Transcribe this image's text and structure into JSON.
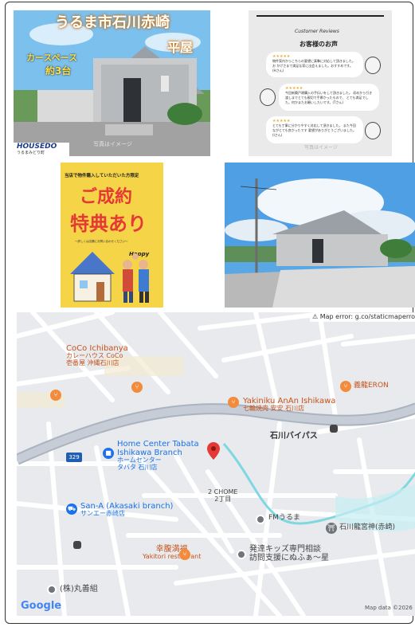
{
  "listing_photo_1": {
    "title": "うるま市石川赤崎",
    "subtitle": "平屋",
    "parking_line1": "カースペース",
    "parking_line2": "約3台",
    "brand": "HOUSEDO",
    "branch": "うるまみどり町",
    "watermark": "写真はイメージ"
  },
  "reviews_card": {
    "heading_en": "Customer Reviews",
    "heading_jp": "お客様のお声",
    "reviews": [
      {
        "stars": "★★★★★",
        "text": "物件案内からこちらの要望に真摯に対応して頂きました。お かげさまで満足な家に出会えました。おすすめです。 (Hさん)"
      },
      {
        "stars": "★★★★★",
        "text": "今回新築戸建購入の手伝いをして頂きました。 初めから引き渡しまでとても親切で手厚かったもので、 とても満足でした。何かまたお願いしたいです。(Tさん)"
      },
      {
        "stars": "★★★★★",
        "text": "とても丁寧に分かりやすく対応して頂きました。 また今回ながとても良かったです 要望がありがとうございました。 (Iさん)"
      }
    ],
    "watermark": "写真はイメージ"
  },
  "campaign_card": {
    "top_text": "当店で物件購入していただいた方限定",
    "headline1": "ご成約",
    "headline2": "特典あり",
    "small_text": "～詳しくは店舗にお問い合わせください～",
    "happy": "Happy"
  },
  "map": {
    "error_text": "Map error: g.co/staticmaperror",
    "google_label": "Google",
    "attribution": "Map data ©2026",
    "route_badge": "329",
    "places": [
      {
        "name": "CoCo Ichibanya",
        "sub1": "カレーハウス CoCo",
        "sub2": "壱番屋 沖縄石川店"
      },
      {
        "name": "Yakiniku AnAn Ishikawa",
        "sub1": "七輪焼肉 安安 石川店"
      },
      {
        "name": "義龍ERON"
      },
      {
        "name": "石川バイパス"
      },
      {
        "name": "Home Center Tabata",
        "sub1": "Ishikawa Branch",
        "sub2": "ホームセンター",
        "sub3": "タバタ 石川店"
      },
      {
        "name": "2 CHOME",
        "sub1": "2丁目"
      },
      {
        "name": "San-A (Akasaki branch)",
        "sub1": "サンエー赤崎店"
      },
      {
        "name": "FMうるま"
      },
      {
        "name": "石川龍宮神(赤崎)"
      },
      {
        "name": "幸腹満福",
        "sub1": "Yakitori restaurant"
      },
      {
        "name": "発達キッズ専門相談",
        "sub1": "訪問支援にぬふぁ～星"
      },
      {
        "name": "(株)丸善組"
      }
    ],
    "colors": {
      "road": "#ffffff",
      "arterial": "#aab3c0",
      "water": "#7fd8e0",
      "food": "#f28b3c",
      "shop": "#1a73e8",
      "poi": "#70757a",
      "pin": "#e53935"
    }
  }
}
